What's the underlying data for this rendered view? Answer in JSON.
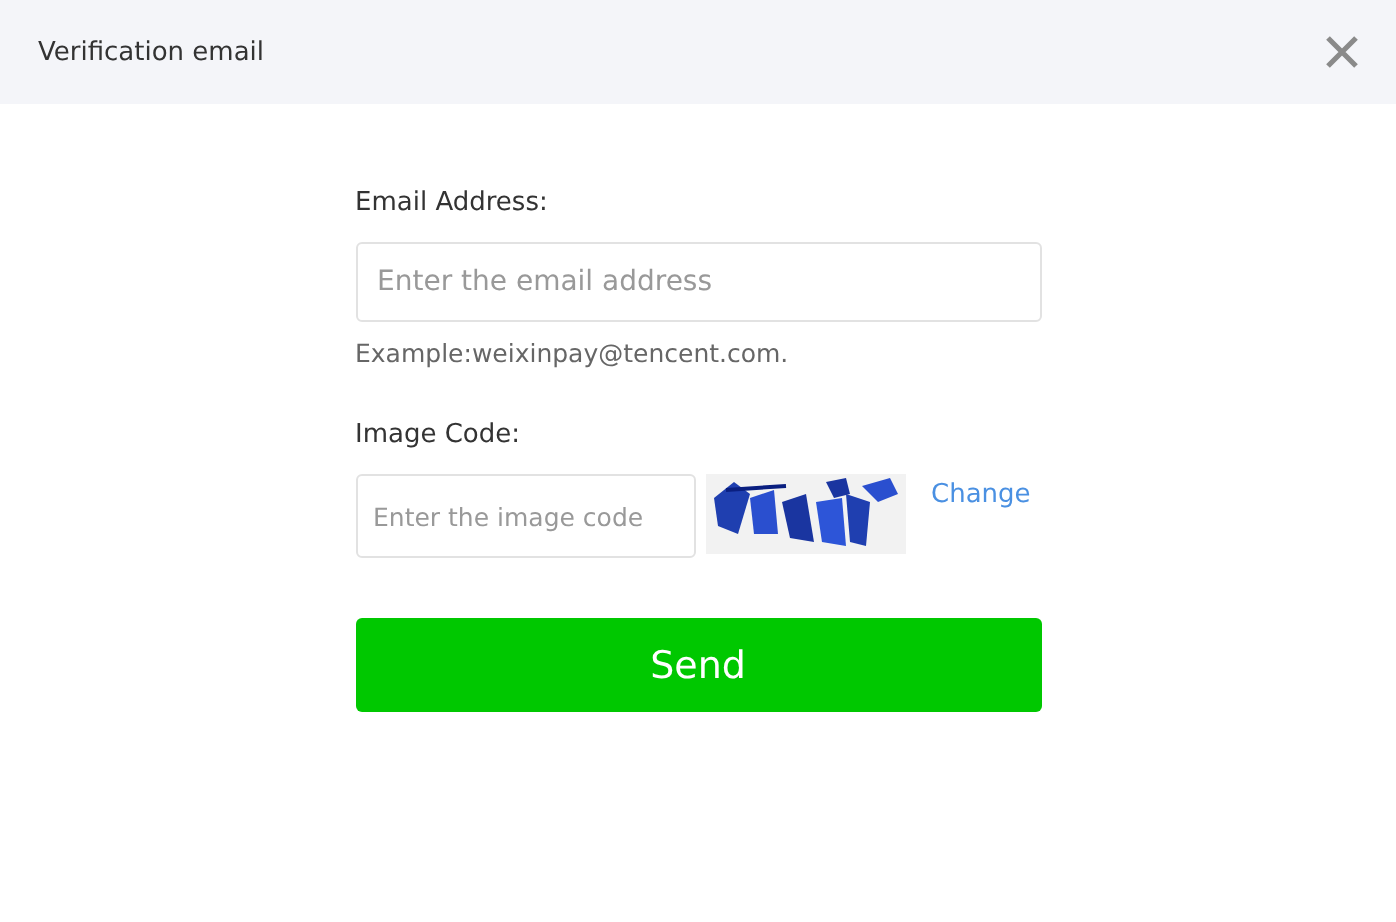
{
  "window": {
    "title": "Verification email"
  },
  "email": {
    "label": "Email Address:",
    "placeholder": "Enter the email address",
    "hint": "Example:weixinpay@tencent.com."
  },
  "image_code": {
    "label": "Image Code:",
    "placeholder": "Enter the image code",
    "change_link": "Change"
  },
  "buttons": [
    "Send"
  ]
}
